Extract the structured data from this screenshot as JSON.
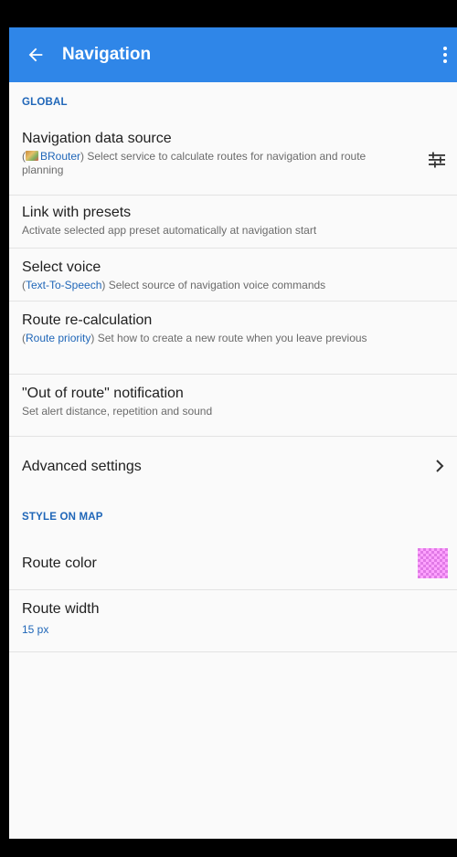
{
  "app_bar": {
    "title": "Navigation",
    "back_icon": "arrow-back-icon",
    "more_icon": "more-vert-icon",
    "color": "#2f86e8"
  },
  "sections": {
    "global": "GLOBAL",
    "style_on_map": "STYLE ON MAP"
  },
  "prefs": {
    "nav_source": {
      "title": "Navigation data source",
      "value": "BRouter",
      "open": "(",
      "summary_rest": ") Select service to calculate routes for navigation and route planning",
      "icon": "tune-icon"
    },
    "presets": {
      "title": "Link with presets",
      "summary": "Activate selected app preset automatically at navigation start"
    },
    "voice": {
      "title": "Select voice",
      "open": "(",
      "value": "Text-To-Speech",
      "summary_rest": ") Select source of navigation voice commands"
    },
    "recalc": {
      "title": "Route re-calculation",
      "open": "(",
      "value": "Route priority",
      "summary_rest": ") Set how to create a new route when you leave previous"
    },
    "out_of_route": {
      "title": "\"Out of route\" notification",
      "summary": "Set alert distance, repetition and sound"
    },
    "advanced": {
      "title": "Advanced settings",
      "icon": "chevron-right-icon"
    },
    "route_color": {
      "title": "Route color",
      "swatch_color": "#e07ae6"
    },
    "route_width": {
      "title": "Route width",
      "value": "15 px"
    }
  },
  "accent_color": "#1f66b8"
}
